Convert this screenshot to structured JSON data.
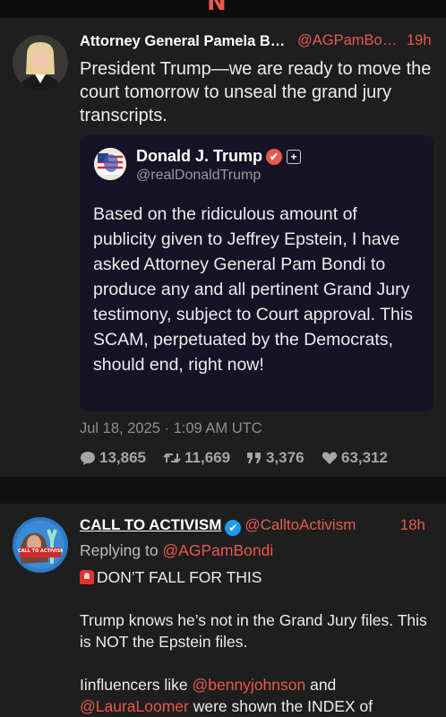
{
  "tweet1": {
    "author_name": "Attorney General Pamela B…",
    "author_handle": "@AGPamBo…",
    "time": "19h",
    "text": "President Trump—we are ready to move the court tomorrow to unseal the grand jury transcripts.",
    "quote": {
      "author_name": "Donald J. Trump",
      "author_handle": "@realDonaldTrump",
      "text": "Based on the ridiculous amount of publicity given to Jeffrey Epstein, I have asked Attorney General Pam Bondi to produce any and all pertinent Grand Jury testimony, subject to Court approval. This SCAM, perpetuated by the Democrats, should end, right now!"
    },
    "date": "Jul 18, 2025 · 1:09 AM UTC",
    "stats": {
      "replies": "13,865",
      "retweets": "11,669",
      "quotes": "3,376",
      "likes": "63,312"
    }
  },
  "tweet2": {
    "author_name": "CALL TO ACTIVISM",
    "author_handle": "@CalltoActivism",
    "time": "18h",
    "replying_prefix": "Replying to ",
    "replying_to": "@AGPamBondi",
    "line1": "DON’T FALL FOR THIS",
    "line2": "Trump knows he’s not in the Grand Jury files. This is NOT the Epstein files.",
    "line3_prefix": "Iinfluencers like ",
    "mention1": "@bennyjohnson",
    "line3_suffix": " and",
    "mention2": "@LauraLoomer",
    "line4_suffix": " were shown the INDEX of",
    "avatar_text": "CALL TO ACTIVISM"
  },
  "colors": {
    "accent": "#e8594e",
    "background": "#111111",
    "card": "#1e1e1e",
    "quote_bg": "#151325",
    "verified_blue": "#1d9bf0"
  },
  "icons": [
    "n-logo",
    "reply-icon",
    "retweet-icon",
    "quote-icon",
    "heart-icon",
    "verified-badge-icon",
    "plus-icon",
    "alarm-icon"
  ]
}
